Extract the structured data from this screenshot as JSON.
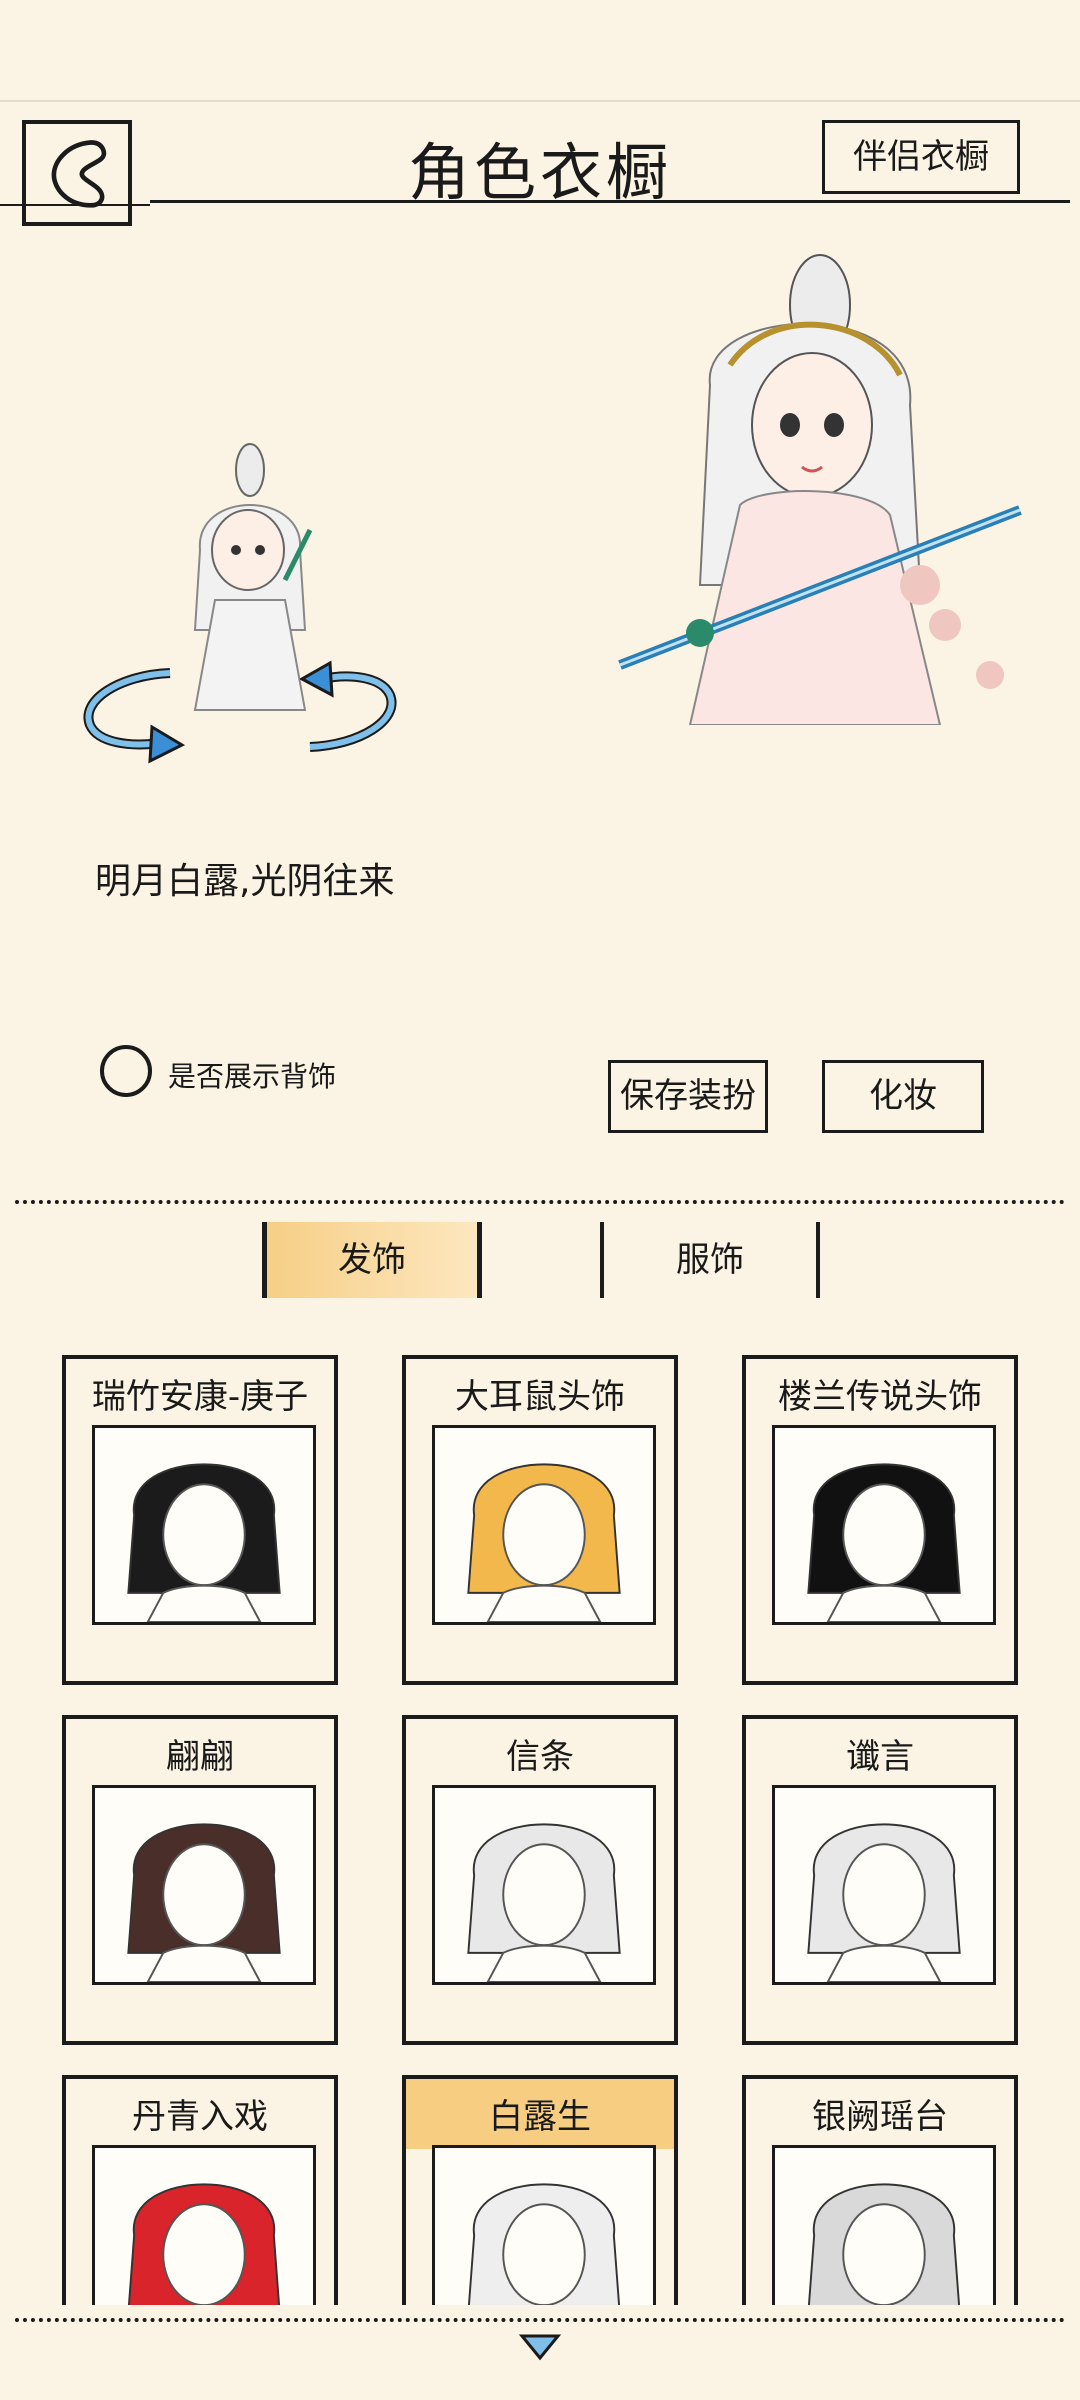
{
  "header": {
    "title": "角色衣橱",
    "partner_button": "伴侣衣橱"
  },
  "outfit": {
    "name": "明月白露,光阴往来",
    "show_back_label": "是否展示背饰",
    "save_button": "保存装扮",
    "makeup_button": "化妆"
  },
  "tabs": {
    "hair": "发饰",
    "clothes": "服饰",
    "active": "hair"
  },
  "items": [
    {
      "name": "瑞竹安康-庚子",
      "hair": "#1b1b1b"
    },
    {
      "name": "大耳鼠头饰",
      "hair": "#f2b84b"
    },
    {
      "name": "楼兰传说头饰",
      "hair": "#111111"
    },
    {
      "name": "翩翩",
      "hair": "#4a2e2a"
    },
    {
      "name": "信条",
      "hair": "#e8e8e8"
    },
    {
      "name": "谶言",
      "hair": "#e8e8e8"
    },
    {
      "name": "丹青入戏",
      "hair": "#d8242a"
    },
    {
      "name": "白露生",
      "hair": "#eeeeee",
      "selected": true
    },
    {
      "name": "银阙瑶台",
      "hair": "#d9d9d9"
    }
  ],
  "colors": {
    "background": "#fbf3e3",
    "accent": "#f6cf86",
    "ink": "#1b1b1b"
  }
}
